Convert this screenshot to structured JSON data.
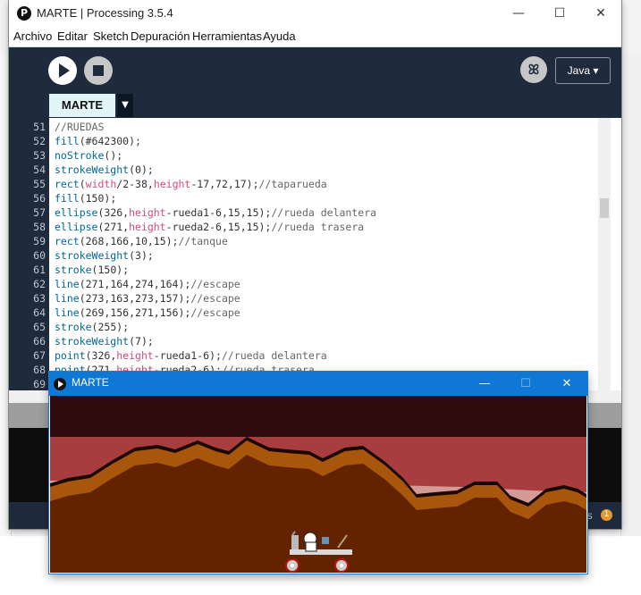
{
  "window": {
    "app_icon": "processing-icon",
    "title": "MARTE | Processing 3.5.4",
    "minimize": "—",
    "maximize": "☐",
    "close": "✕"
  },
  "menu": [
    "Archivo",
    "Editar",
    "Sketch",
    "Depuración",
    "Herramientas",
    "Ayuda"
  ],
  "toolbar": {
    "run_icon": "play-icon",
    "stop_icon": "stop-icon",
    "debug_icon": "butterfly-debug-icon",
    "debug_glyph": "ꕤ",
    "mode": "Java ▾"
  },
  "tabs": {
    "active": "MARTE",
    "menu_arrow": "▼"
  },
  "code_lines": [
    {
      "n": "51",
      "segs": [
        [
          "c",
          "//RUEDAS"
        ]
      ]
    },
    {
      "n": "52",
      "segs": [
        [
          "k",
          "fill"
        ],
        [
          "t",
          "(#642300);"
        ]
      ]
    },
    {
      "n": "53",
      "segs": [
        [
          "k",
          "noStroke"
        ],
        [
          "t",
          "();"
        ]
      ]
    },
    {
      "n": "54",
      "segs": [
        [
          "k",
          "strokeWeight"
        ],
        [
          "t",
          "(0);"
        ]
      ]
    },
    {
      "n": "55",
      "segs": [
        [
          "k",
          "rect"
        ],
        [
          "t",
          "("
        ],
        [
          "v",
          "width"
        ],
        [
          "t",
          "/2-38,"
        ],
        [
          "v",
          "height"
        ],
        [
          "t",
          "-17,72,17);"
        ],
        [
          "c",
          "//taparueda"
        ]
      ]
    },
    {
      "n": "56",
      "segs": [
        [
          "k",
          "fill"
        ],
        [
          "t",
          "(150);"
        ]
      ]
    },
    {
      "n": "57",
      "segs": [
        [
          "k",
          "ellipse"
        ],
        [
          "t",
          "(326,"
        ],
        [
          "v",
          "height"
        ],
        [
          "t",
          "-rueda1-6,15,15);"
        ],
        [
          "c",
          "//rueda delantera"
        ]
      ]
    },
    {
      "n": "58",
      "segs": [
        [
          "k",
          "ellipse"
        ],
        [
          "t",
          "(271,"
        ],
        [
          "v",
          "height"
        ],
        [
          "t",
          "-rueda2-6,15,15);"
        ],
        [
          "c",
          "//rueda trasera"
        ]
      ]
    },
    {
      "n": "59",
      "segs": [
        [
          "k",
          "rect"
        ],
        [
          "t",
          "(268,166,10,15);"
        ],
        [
          "c",
          "//tanque"
        ]
      ]
    },
    {
      "n": "60",
      "segs": [
        [
          "k",
          "strokeWeight"
        ],
        [
          "t",
          "(3);"
        ]
      ]
    },
    {
      "n": "61",
      "segs": [
        [
          "k",
          "stroke"
        ],
        [
          "t",
          "(150);"
        ]
      ]
    },
    {
      "n": "62",
      "segs": [
        [
          "k",
          "line"
        ],
        [
          "t",
          "(271,164,274,164);"
        ],
        [
          "c",
          "//escape"
        ]
      ]
    },
    {
      "n": "63",
      "segs": [
        [
          "k",
          "line"
        ],
        [
          "t",
          "(273,163,273,157);"
        ],
        [
          "c",
          "//escape"
        ]
      ]
    },
    {
      "n": "64",
      "segs": [
        [
          "k",
          "line"
        ],
        [
          "t",
          "(269,156,271,156);"
        ],
        [
          "c",
          "//escape"
        ]
      ]
    },
    {
      "n": "65",
      "segs": [
        [
          "k",
          "stroke"
        ],
        [
          "t",
          "(255);"
        ]
      ]
    },
    {
      "n": "66",
      "segs": [
        [
          "k",
          "strokeWeight"
        ],
        [
          "t",
          "(7);"
        ]
      ]
    },
    {
      "n": "67",
      "segs": [
        [
          "k",
          "point"
        ],
        [
          "t",
          "(326,"
        ],
        [
          "v",
          "height"
        ],
        [
          "t",
          "-rueda1-6);"
        ],
        [
          "c",
          "//rueda delantera"
        ]
      ]
    },
    {
      "n": "68",
      "segs": [
        [
          "k",
          "point"
        ],
        [
          "t",
          "(271,"
        ],
        [
          "v",
          "height"
        ],
        [
          "t",
          "-rueda2-6);"
        ],
        [
          "c",
          "//rueda trasera"
        ]
      ]
    },
    {
      "n": "69",
      "segs": []
    }
  ],
  "status": {
    "errors_label": "es",
    "errors_count": "1"
  },
  "sketch": {
    "title": "MARTE",
    "minimize": "—",
    "maximize": "☐",
    "close": "✕"
  },
  "colors": {
    "editor_bg": "#1f2b3c",
    "keyword": "#006699",
    "comment": "#666666",
    "variable": "#d94a7a",
    "sky": "#2e0c0d",
    "far_band": "#a83d3f",
    "mid_band": "#d49a95",
    "mountain_edge": "#a8560b",
    "ground": "#642300"
  }
}
